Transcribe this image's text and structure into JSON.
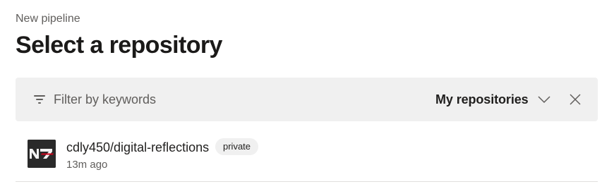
{
  "header": {
    "eyebrow": "New pipeline",
    "title": "Select a repository"
  },
  "filter": {
    "placeholder": "Filter by keywords",
    "icon": "filter-icon",
    "scope_label": "My repositories",
    "scope_icon": "chevron-down-icon",
    "close_icon": "close-icon"
  },
  "repositories": [
    {
      "name": "cdly450/digital-reflections",
      "visibility": "private",
      "updated": "13m ago",
      "avatar_text": "N7",
      "avatar_icon": "n7-logo-avatar"
    }
  ],
  "colors": {
    "filter_bar_bg": "#f0f0f0",
    "badge_bg": "#f0f0f0",
    "secondary_text": "#605e5c",
    "avatar_bg": "#2a2a2a",
    "avatar_accent": "#d0021b"
  }
}
